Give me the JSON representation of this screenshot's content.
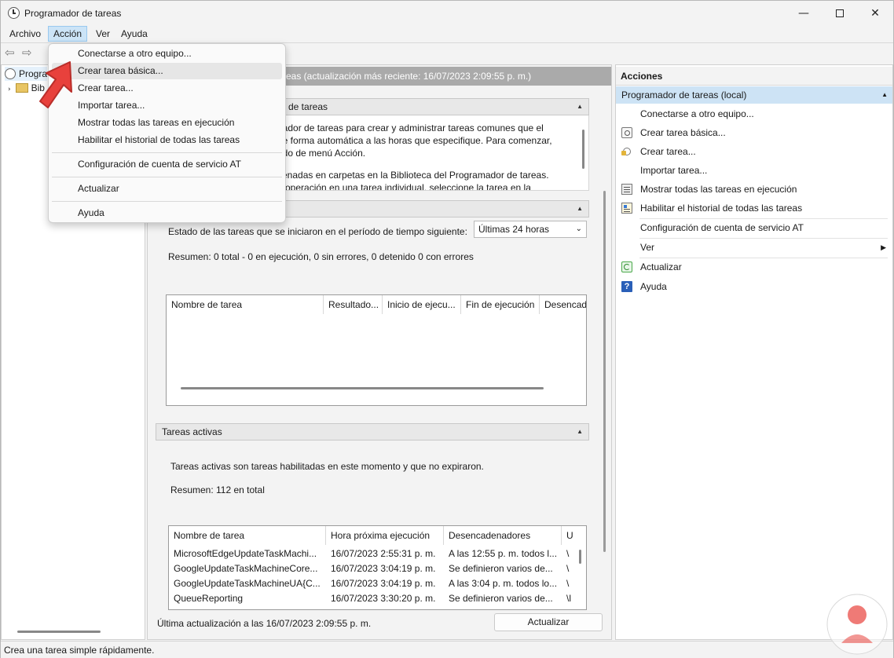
{
  "window": {
    "title": "Programador de tareas",
    "minimize_icon": "minimize-icon",
    "maximize_icon": "maximize-icon",
    "close_icon": "close-icon"
  },
  "menubar": {
    "items": [
      "Archivo",
      "Acción",
      "Ver",
      "Ayuda"
    ],
    "active": "Acción"
  },
  "tree": {
    "root": "Programador de tareas (local)",
    "root_visible": "Progra",
    "child_visible": "Bib"
  },
  "center": {
    "header": "Resumen del Programador de tareas (actualización más reciente: 16/07/2023 2:09:55 p. m.)",
    "header_visible": "eas (actualización más reciente: 16/07/2023 2:09:55 p. m.)",
    "overview": {
      "title_visible": "de tareas",
      "lines": [
        "nador de tareas para crear y administrar tareas comunes que el",
        "de forma automática a las horas que especifique. Para comenzar,",
        "ndo de menú Acción.",
        "",
        "cenadas en carpetas en la Biblioteca del Programador de tareas.",
        "a operación en una tarea individual, seleccione la tarea en la"
      ]
    },
    "status": {
      "label": "Estado de las tareas que se iniciaron en el período de tiempo siguiente:",
      "period": "Últimas 24 horas",
      "summary": "Resumen: 0 total - 0 en ejecución, 0 sin errores, 0 detenido   0 con errores",
      "columns": [
        "Nombre de tarea",
        "Resultado...",
        "Inicio de ejecu...",
        "Fin de ejecución",
        "Desencad"
      ]
    },
    "active_tasks": {
      "title": "Tareas activas",
      "description": "Tareas activas son tareas habilitadas en este momento y que no expiraron.",
      "summary": "Resumen: 112 en total",
      "columns": [
        "Nombre de tarea",
        "Hora próxima ejecución",
        "Desencadenadores",
        "U"
      ],
      "rows": [
        [
          "MicrosoftEdgeUpdateTaskMachi...",
          "16/07/2023 2:55:31 p. m.",
          "A las 12:55 p. m. todos l...",
          "\\"
        ],
        [
          "GoogleUpdateTaskMachineCore...",
          "16/07/2023 3:04:19 p. m.",
          "Se definieron varios de...",
          "\\"
        ],
        [
          "GoogleUpdateTaskMachineUA{C...",
          "16/07/2023 3:04:19 p. m.",
          "A las 3:04 p. m. todos lo...",
          "\\"
        ],
        [
          "QueueReporting",
          "16/07/2023 3:30:20 p. m.",
          "Se definieron varios de...",
          "\\l"
        ]
      ]
    },
    "footer": {
      "last_update": "Última actualización a las 16/07/2023 2:09:55 p. m.",
      "refresh_button": "Actualizar"
    }
  },
  "actions": {
    "title": "Acciones",
    "group": "Programador de tareas (local)",
    "items": [
      {
        "label": "Conectarse a otro equipo...",
        "icon": ""
      },
      {
        "label": "Crear tarea básica...",
        "icon": "basic-task-icon"
      },
      {
        "label": "Crear tarea...",
        "icon": "create-task-icon"
      },
      {
        "label": "Importar tarea...",
        "icon": ""
      },
      {
        "label": "Mostrar todas las tareas en ejecución",
        "icon": "running-tasks-icon"
      },
      {
        "label": "Habilitar el historial de todas las tareas",
        "icon": "history-icon"
      },
      {
        "label": "Configuración de cuenta de servicio AT",
        "icon": ""
      },
      {
        "label": "Ver",
        "icon": "",
        "submenu": "▶"
      },
      {
        "label": "Actualizar",
        "icon": "refresh-icon"
      },
      {
        "label": "Ayuda",
        "icon": "help-icon"
      }
    ]
  },
  "dropdown": {
    "items": [
      "Conectarse a otro equipo...",
      "Crear tarea básica...",
      "Crear tarea...",
      "Importar tarea...",
      "Mostrar todas las tareas en ejecución",
      "Habilitar el historial de todas las tareas",
      "Configuración de cuenta de servicio AT",
      "Actualizar",
      "Ayuda"
    ],
    "highlighted": "Crear tarea básica..."
  },
  "statusbar": {
    "text": "Crea una tarea simple rápidamente."
  },
  "colors": {
    "accent_selected": "#cde3f5",
    "header_gray": "#aaaaaa",
    "pointer_red": "#e8413c"
  }
}
